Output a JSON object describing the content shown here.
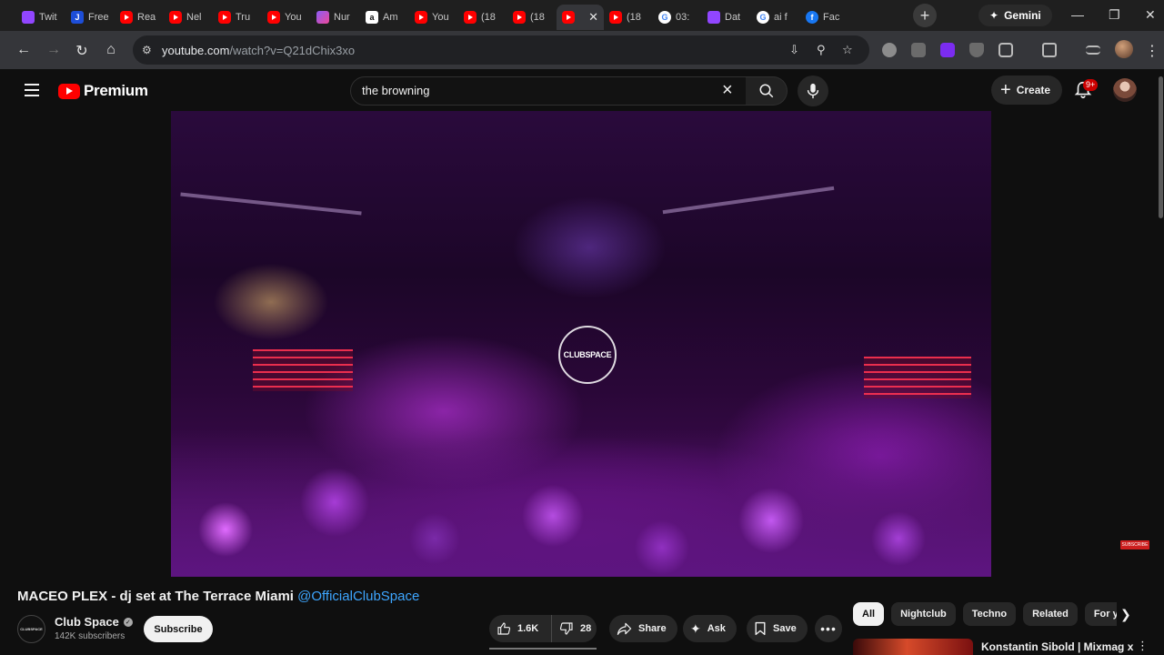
{
  "browser": {
    "tabs": [
      {
        "label": "Twit",
        "icon": "twitch-icon",
        "favicon": "twitch"
      },
      {
        "label": "Free",
        "icon": "j-icon",
        "favicon": "j"
      },
      {
        "label": "Rea",
        "icon": "youtube-icon",
        "favicon": "yt"
      },
      {
        "label": "Nel",
        "icon": "youtube-icon",
        "favicon": "yt"
      },
      {
        "label": "Tru",
        "icon": "youtube-icon",
        "favicon": "yt"
      },
      {
        "label": "You",
        "icon": "youtube-icon",
        "favicon": "yt"
      },
      {
        "label": "Nur",
        "icon": "nu-icon",
        "favicon": "nu"
      },
      {
        "label": "Am",
        "icon": "amazon-icon",
        "favicon": "amz"
      },
      {
        "label": "You",
        "icon": "youtube-icon",
        "favicon": "yt"
      },
      {
        "label": "(18",
        "icon": "youtube-icon",
        "favicon": "yt"
      },
      {
        "label": "(18",
        "icon": "youtube-icon",
        "favicon": "yt"
      },
      {
        "label": "",
        "icon": "youtube-icon",
        "favicon": "yt",
        "active": true
      },
      {
        "label": "(18",
        "icon": "youtube-icon",
        "favicon": "yt"
      },
      {
        "label": "03:",
        "icon": "google-icon",
        "favicon": "g"
      },
      {
        "label": "Dat",
        "icon": "twitch-icon",
        "favicon": "twitch"
      },
      {
        "label": "ai f",
        "icon": "google-icon",
        "favicon": "g"
      },
      {
        "label": "Fac",
        "icon": "facebook-icon",
        "favicon": "fb"
      }
    ],
    "gemini_label": "Gemini",
    "url_host": "youtube.com",
    "url_path": "/watch?v=Q21dChix3xo"
  },
  "youtube": {
    "brand": "Premium",
    "search_value": "the browning",
    "create_label": "Create",
    "notifications_badge": "9+",
    "player_logo_text": "CLUBSPACE",
    "watermark_text": "SUBSCRIBE",
    "video": {
      "title": "MACEO PLEX - dj set at The Terrace Miami",
      "title_handle": "@OfficialClubSpace",
      "channel_avatar_text": "CLUBSPACE",
      "channel_name": "Club Space",
      "subscribers": "142K subscribers",
      "subscribe_label": "Subscribe",
      "likes": "1.6K",
      "dislikes": "28",
      "share_label": "Share",
      "ask_label": "Ask",
      "save_label": "Save"
    },
    "chips": [
      "All",
      "Nightclub",
      "Techno",
      "Related",
      "For you"
    ],
    "recommendation_title": "Konstantin Sibold | Mixmag x"
  },
  "colors": {
    "accent_red": "#ff0000",
    "link_blue": "#3ea6ff",
    "background": "#0f0f0f"
  }
}
